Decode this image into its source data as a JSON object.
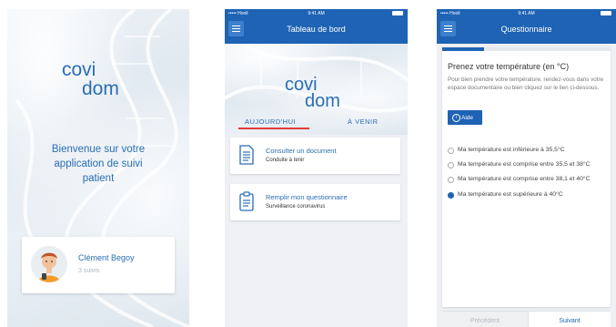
{
  "splash": {
    "logo_line1": "covi",
    "logo_line2": "dom",
    "welcome_text": "Bienvenue sur votre application de suivi patient",
    "patient_name": "Clément Begoy",
    "patient_sub": "3 suivis"
  },
  "dashboard": {
    "status_carrier": "••••• Hooli ",
    "status_time": "9:41 AM",
    "title": "Tableau de bord",
    "logo_line1": "covi",
    "logo_line2": "dom",
    "tabs": [
      {
        "label": "AUJOURD'HUI",
        "active": true
      },
      {
        "label": "À VENIR",
        "active": false
      }
    ],
    "cards": [
      {
        "title": "Consulter un document",
        "subtitle": "Conduite à tenir"
      },
      {
        "title": "Remplir mon questionnaire",
        "subtitle": "Surveillance coronavirus"
      }
    ]
  },
  "questionnaire": {
    "status_carrier": "••••• Hooli ",
    "status_time": "9:41 AM",
    "title": "Questionnaire",
    "progress_fraction": 0.25,
    "question": "Prenez votre température (en °C)",
    "description": "Pour bien prendre votre température, rendez-vous dans votre espace documentaire ou bien cliquez sur le lien ci-dessous.",
    "help_label": "Aide",
    "options": [
      {
        "label": "Ma température est inférieure à 35,5°C",
        "selected": false
      },
      {
        "label": "Ma température est comprise entre 35,5 et 38°C",
        "selected": false
      },
      {
        "label": "Ma température est comprise entre 38,1 et 40°C",
        "selected": false
      },
      {
        "label": "Ma température est supérieure à 40°C",
        "selected": true
      }
    ],
    "prev_label": "Précédent",
    "next_label": "Suivant"
  },
  "colors": {
    "primary": "#1e63b4",
    "logo": "#2a6db5",
    "tab_indicator": "#e03b3b"
  }
}
